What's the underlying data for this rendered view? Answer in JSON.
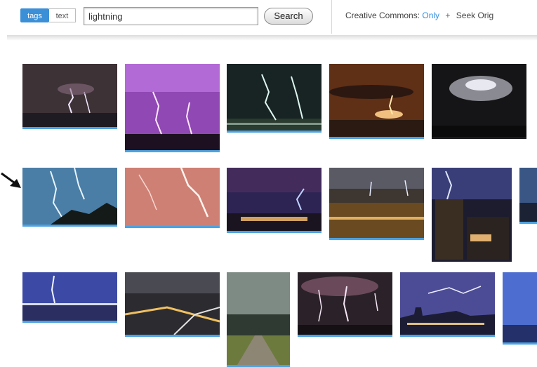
{
  "search_bar": {
    "tabs": [
      {
        "label": "tags",
        "active": true
      },
      {
        "label": "text",
        "active": false
      }
    ],
    "query_value": "lightning",
    "search_button_label": "Search"
  },
  "filters": {
    "creative_commons_label": "Creative Commons:",
    "creative_commons_value": "Only",
    "separator": "+",
    "seek_original_label": "Seek Orig"
  },
  "colors": {
    "accent": "#3b8fd6",
    "thumb_border": "#4ca3e3"
  },
  "results": {
    "rows": [
      {
        "thumbs": [
          {
            "name": "storm-over-water-bolts",
            "bg": "#3a3033"
          },
          {
            "name": "purple-sky-lightning",
            "bg": "#8a3fa8"
          },
          {
            "name": "green-night-city-bolts",
            "bg": "#1d2a2a"
          },
          {
            "name": "orange-dusk-strike",
            "bg": "#6a3518"
          },
          {
            "name": "dark-cloud-flash",
            "bg": "#1b1b1d"
          }
        ]
      },
      {
        "thumbs": [
          {
            "name": "blue-sky-forked-bolts",
            "bg": "#3d6f95"
          },
          {
            "name": "pink-haze-lightning",
            "bg": "#c8776e"
          },
          {
            "name": "purple-night-town-strike",
            "bg": "#2c2450"
          },
          {
            "name": "city-lights-storm",
            "bg": "#3e342c"
          },
          {
            "name": "tower-block-lightning",
            "bg": "#1e1e30"
          },
          {
            "name": "blue-partial-thumb",
            "bg": "#35507a"
          }
        ]
      },
      {
        "thumbs": [
          {
            "name": "bay-lightning-reflection",
            "bg": "#3b4aa0"
          },
          {
            "name": "highway-storm-night",
            "bg": "#2a2a2c"
          },
          {
            "name": "road-under-storm-cloud",
            "bg": "#5e6a5a"
          },
          {
            "name": "multi-strike-night",
            "bg": "#28222a"
          },
          {
            "name": "skyline-purple-bolt",
            "bg": "#4a4a90"
          },
          {
            "name": "blue-edge-thumb",
            "bg": "#4b6cc8"
          }
        ]
      }
    ]
  }
}
